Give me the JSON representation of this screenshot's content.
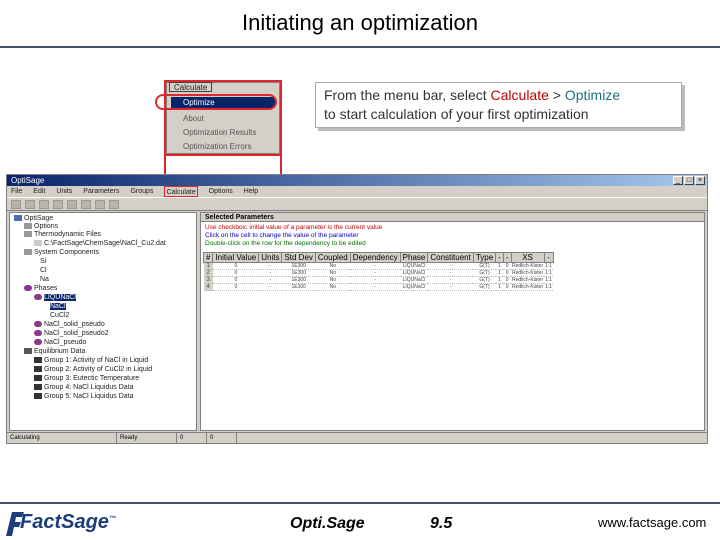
{
  "slide_title": "Initiating an optimization",
  "popup_menu": {
    "title": "Calculate",
    "items": [
      {
        "label": "Optimize",
        "selected": true
      },
      {
        "label": "About",
        "selected": false
      },
      {
        "label": "Optimization Results",
        "selected": false
      },
      {
        "label": "Optimization Errors",
        "selected": false
      }
    ]
  },
  "note": {
    "prefix": "From the menu bar, select ",
    "menu": "Calculate",
    "separator": " > ",
    "command": "Optimize",
    "suffix": "to start calculation of your first optimization"
  },
  "app": {
    "title": "OptiSage",
    "menu": [
      "File",
      "Edit",
      "Units",
      "Parameters",
      "Groups",
      "Calculate",
      "Options",
      "Help"
    ],
    "highlighted_menu": "Calculate",
    "tree": [
      {
        "label": "OptiSage",
        "depth": 0
      },
      {
        "label": "Options",
        "depth": 1
      },
      {
        "label": "Thermodynamic Files",
        "depth": 1
      },
      {
        "label": "C:\\FactSage\\ChemSage\\NaCl_Cu2.dat",
        "depth": 2
      },
      {
        "label": "System Components",
        "depth": 1
      },
      {
        "label": "Si",
        "depth": 2
      },
      {
        "label": "Cl",
        "depth": 2
      },
      {
        "label": "Na",
        "depth": 2
      },
      {
        "label": "Phases",
        "depth": 1
      },
      {
        "label": "LIQUNaCl",
        "depth": 2
      },
      {
        "label": "NaCl",
        "depth": 3
      },
      {
        "label": "CuCl2",
        "depth": 3
      },
      {
        "label": "NaCl_solid_pseudo",
        "depth": 2
      },
      {
        "label": "NaCl_solid_pseudo2",
        "depth": 2
      },
      {
        "label": "NaCl_pseudo",
        "depth": 2
      },
      {
        "label": "Equilibrium Data",
        "depth": 1
      },
      {
        "label": "Group 1: Activity of NaCl in Liquid",
        "depth": 2
      },
      {
        "label": "Group 2: Activity of CuCl2 in Liquid",
        "depth": 2
      },
      {
        "label": "Group 3: Eutectic Temperature",
        "depth": 2
      },
      {
        "label": "Group 4: NaCl Liquidus Data",
        "depth": 2
      },
      {
        "label": "Group 5: NaCl Liquidus Data",
        "depth": 2
      }
    ],
    "pane_title": "Selected Parameters",
    "notes": [
      "Use checkbox: initial value of a parameter is the current value",
      "Click on the cell to change the value of the parameter",
      "Double-click on the row for the dependency to be edited"
    ],
    "columns": [
      "#",
      "Initial Value",
      "Units",
      "Std Dev",
      "Coupled",
      "Dependency",
      "Phase",
      "Constituent",
      "Type",
      "-",
      "-",
      "XS",
      "-"
    ],
    "rows": [
      [
        "1",
        "0",
        "-",
        "1E300",
        "No",
        "-",
        "LIQUNaCl",
        "-",
        "G(T)",
        "1",
        "0",
        "Redlich-Kister",
        "1:1"
      ],
      [
        "2",
        "0",
        "-",
        "1E300",
        "No",
        "-",
        "LIQUNaCl",
        "-",
        "G(T)",
        "1",
        "0",
        "Redlich-Kister",
        "1:1"
      ],
      [
        "3",
        "0",
        "-",
        "1E300",
        "No",
        "-",
        "LIQUNaCl",
        "-",
        "G(T)",
        "1",
        "0",
        "Redlich-Kister",
        "1:1"
      ],
      [
        "4",
        "0",
        "-",
        "1E300",
        "No",
        "-",
        "LIQUNaCl",
        "-",
        "G(T)",
        "1",
        "0",
        "Redlich-Kister",
        "1:1"
      ]
    ],
    "status": [
      "Calculating",
      "Ready",
      "0",
      "0"
    ]
  },
  "footer": {
    "logo": "FactSage",
    "product": "Opti.Sage",
    "page": "9.5",
    "url": "www.factsage.com"
  },
  "colors": {
    "accent_red": "#e0262c",
    "rule": "#44546a",
    "note_menu": "#c00000",
    "note_cmd": "#1f6f7f"
  }
}
